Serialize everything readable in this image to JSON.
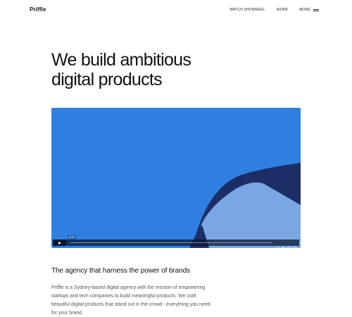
{
  "header": {
    "logo": "Priffle",
    "nav": {
      "showreel": "WATCH SHOWREEL",
      "work": "WORK",
      "more": "MORE"
    }
  },
  "hero": {
    "title_line1": "We build ambitious",
    "title_line2": "digital products"
  },
  "video": {
    "timecode": "0:00",
    "progress": 0.0,
    "background_color": "#2f7fe0",
    "icons": [
      "play-icon",
      "volume-icon",
      "settings-icon",
      "picture-in-picture-icon",
      "fullscreen-icon"
    ]
  },
  "about": {
    "tagline": "The agency that harness the power of brands",
    "description": "Priffle is a Sydney-based digital agency with the mission of empowering startups and tech companies to build meaningful products. We craft beautiful digital products that stand out in the crowd - everything you need for your brand."
  }
}
